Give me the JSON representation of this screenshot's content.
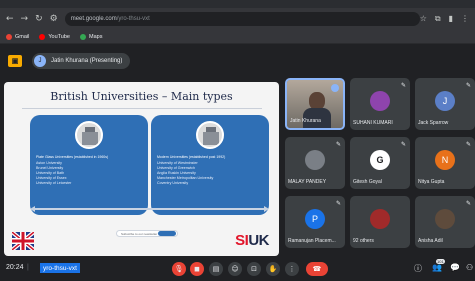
{
  "browser": {
    "url_host": "meet.google.com",
    "url_path": "/yro-thsu-vxt",
    "bookmarks": [
      {
        "label": "Gmail",
        "color": "#ea4335"
      },
      {
        "label": "YouTube",
        "color": "#ff0000"
      },
      {
        "label": "Maps",
        "color": "#34a853"
      }
    ]
  },
  "meet": {
    "presenter_label": "Jatin Khurana (Presenting)",
    "presenter_initial": "J"
  },
  "slide": {
    "title": "British Universities – Main types",
    "left_panel": {
      "heading": "Plate Glass Universities (established in 1960s)",
      "items": [
        "Aston University",
        "Brunel University",
        "University of Bath",
        "University of Essex",
        "University of Leicester"
      ]
    },
    "right_panel": {
      "heading": "Modern Universities (established post 1992)",
      "items": [
        "University of Westminster",
        "University of Greenwich",
        "Anglia Ruskin University",
        "Manchester Metropolitan University",
        "Coventry University"
      ]
    },
    "pill_text": "Subscribe to our newsletter",
    "logo_left": "SI",
    "logo_right": "UK"
  },
  "participants": [
    {
      "name": "Jatin Khurana",
      "type": "video"
    },
    {
      "name": "SUHANI KUMARI",
      "initial": "",
      "color": "#8e44ad"
    },
    {
      "name": "Jack Sparrow",
      "initial": "J",
      "color": "#5b7fc7"
    },
    {
      "name": "MALAY PANDEY",
      "initial": "",
      "color": "#7a7f86"
    },
    {
      "name": "Gitesh Goyal",
      "initial": "G",
      "color": "#ffffff"
    },
    {
      "name": "Nitya Gupta",
      "initial": "N",
      "color": "#e8711a"
    },
    {
      "name": "Ramanujan Placem...",
      "initial": "P",
      "color": "#1a73e8"
    },
    {
      "name": "92 others",
      "initial": "",
      "color": "#a02a2a"
    },
    {
      "name": "Anisha Adil",
      "initial": "",
      "color": "#5e4b3c"
    }
  ],
  "bottom": {
    "time": "20:24",
    "separator": "|",
    "meeting_code": "yro-thsu-vxt",
    "participant_count": "101"
  }
}
